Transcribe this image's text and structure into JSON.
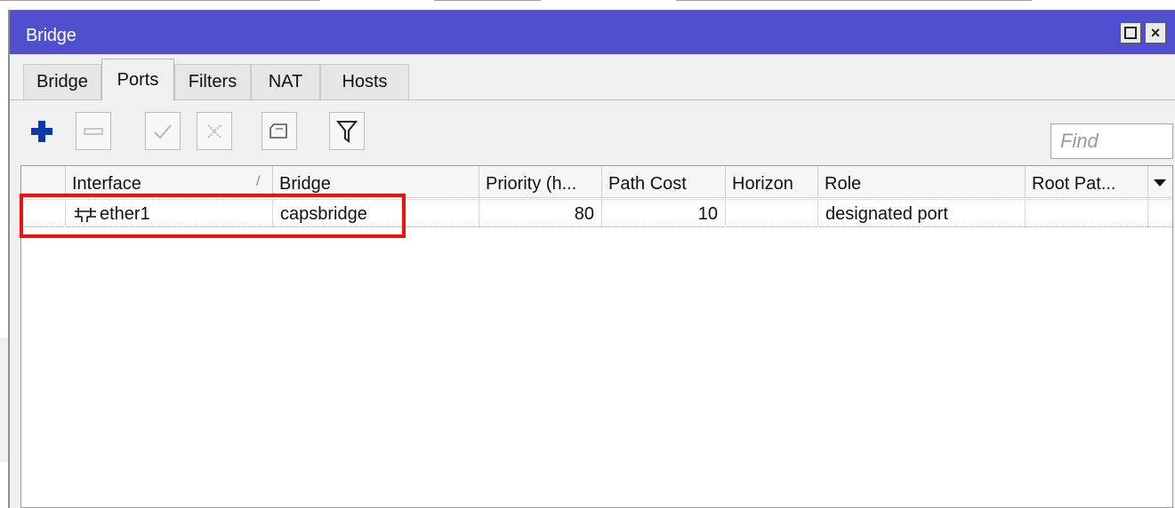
{
  "window": {
    "title": "Bridge",
    "titlebar_color": "#4f4fd0",
    "restore_icon": "restore-icon",
    "close_label": "×"
  },
  "tabs": [
    {
      "label": "Bridge",
      "active": false
    },
    {
      "label": "Ports",
      "active": true
    },
    {
      "label": "Filters",
      "active": false
    },
    {
      "label": "NAT",
      "active": false
    },
    {
      "label": "Hosts",
      "active": false
    }
  ],
  "toolbar": {
    "buttons": [
      {
        "name": "add",
        "icon": "plus-icon",
        "color": "#0a3aa8"
      },
      {
        "name": "remove",
        "icon": "minus-icon"
      },
      {
        "name": "enable",
        "icon": "check-icon"
      },
      {
        "name": "disable",
        "icon": "x-icon"
      },
      {
        "name": "comment",
        "icon": "comment-icon"
      },
      {
        "name": "filter",
        "icon": "funnel-icon"
      }
    ],
    "find_placeholder": "Find"
  },
  "table": {
    "columns": [
      "Interface",
      "Bridge",
      "Priority (h...",
      "Path Cost",
      "Horizon",
      "Role",
      "Root Pat..."
    ],
    "sort_indicator": "/",
    "rows": [
      {
        "interface": "ether1",
        "bridge": "capsbridge",
        "priority": "80",
        "path_cost": "10",
        "horizon": "",
        "role": "designated port",
        "root_path_cost": ""
      }
    ]
  },
  "annotation": {
    "color": "#ee1111"
  }
}
